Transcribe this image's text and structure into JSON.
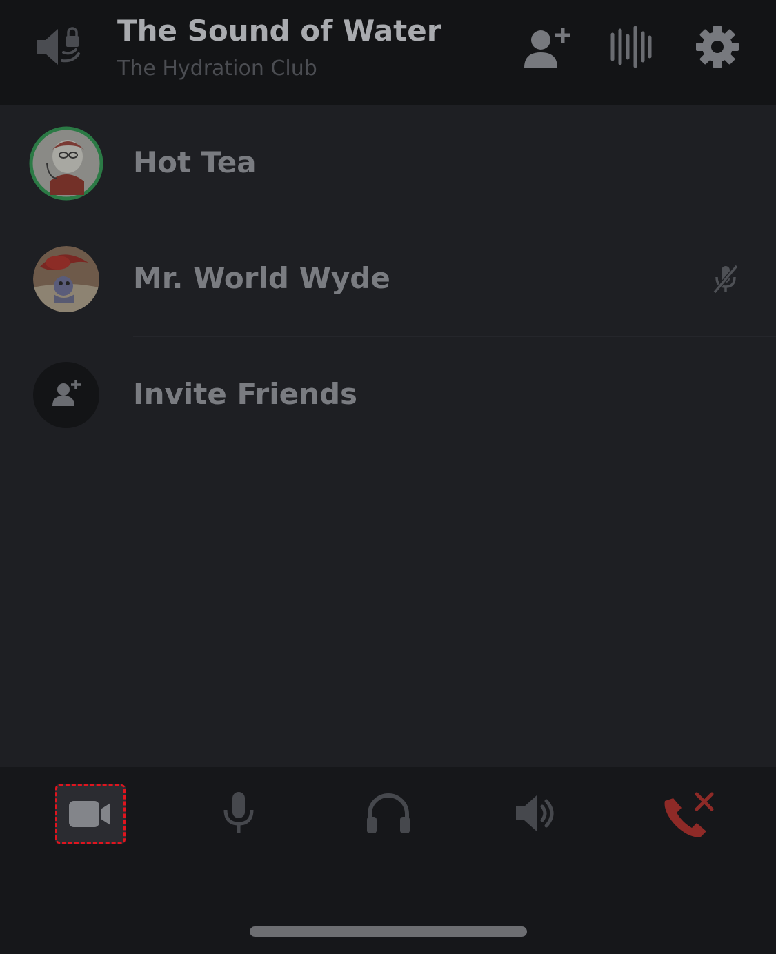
{
  "header": {
    "title": "The Sound of Water",
    "subtitle": "The Hydration Club",
    "channel_icon": "locked-voice-channel-icon",
    "buttons": [
      {
        "icon": "add-member-icon"
      },
      {
        "icon": "voice-activity-icon"
      },
      {
        "icon": "gear-icon"
      }
    ]
  },
  "members": [
    {
      "name": "Hot Tea",
      "speaking": true,
      "muted": false
    },
    {
      "name": "Mr. World Wyde",
      "speaking": false,
      "muted": true
    }
  ],
  "invite": {
    "label": "Invite Friends",
    "icon": "add-person-icon"
  },
  "controls": [
    {
      "icon": "video-camera-icon",
      "highlighted": true
    },
    {
      "icon": "microphone-icon"
    },
    {
      "icon": "headphones-icon"
    },
    {
      "icon": "speaker-icon"
    },
    {
      "icon": "disconnect-call-icon",
      "color": "#8e2a27"
    }
  ],
  "colors": {
    "background": "#1e1f23",
    "header": "#131416",
    "speaking_ring": "#2b7a45",
    "disconnect": "#8e2a27",
    "highlight_border": "#e0141e"
  }
}
